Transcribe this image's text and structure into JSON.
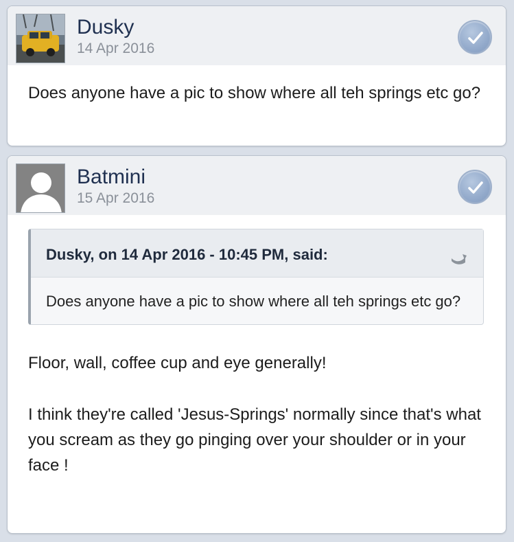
{
  "posts": [
    {
      "author": "Dusky",
      "date": "14 Apr 2016",
      "avatar_icon": "car-photo-icon",
      "body": "Does anyone have a pic to show where all teh springs etc go?"
    },
    {
      "author": "Batmini",
      "date": "15 Apr 2016",
      "avatar_icon": "default-user-icon",
      "quote": {
        "header": "Dusky, on 14 Apr 2016 - 10:45 PM, said:",
        "body": "Does anyone have a pic to show where all teh springs etc go?"
      },
      "paragraphs": [
        "Floor, wall, coffee cup and eye generally!",
        "I think they're called 'Jesus-Springs' normally since that's what you scream as they go pinging over your shoulder or in your face !"
      ]
    }
  ],
  "colors": {
    "background": "#d9dfe8",
    "author": "#1f3050",
    "check": "#93aacb"
  }
}
